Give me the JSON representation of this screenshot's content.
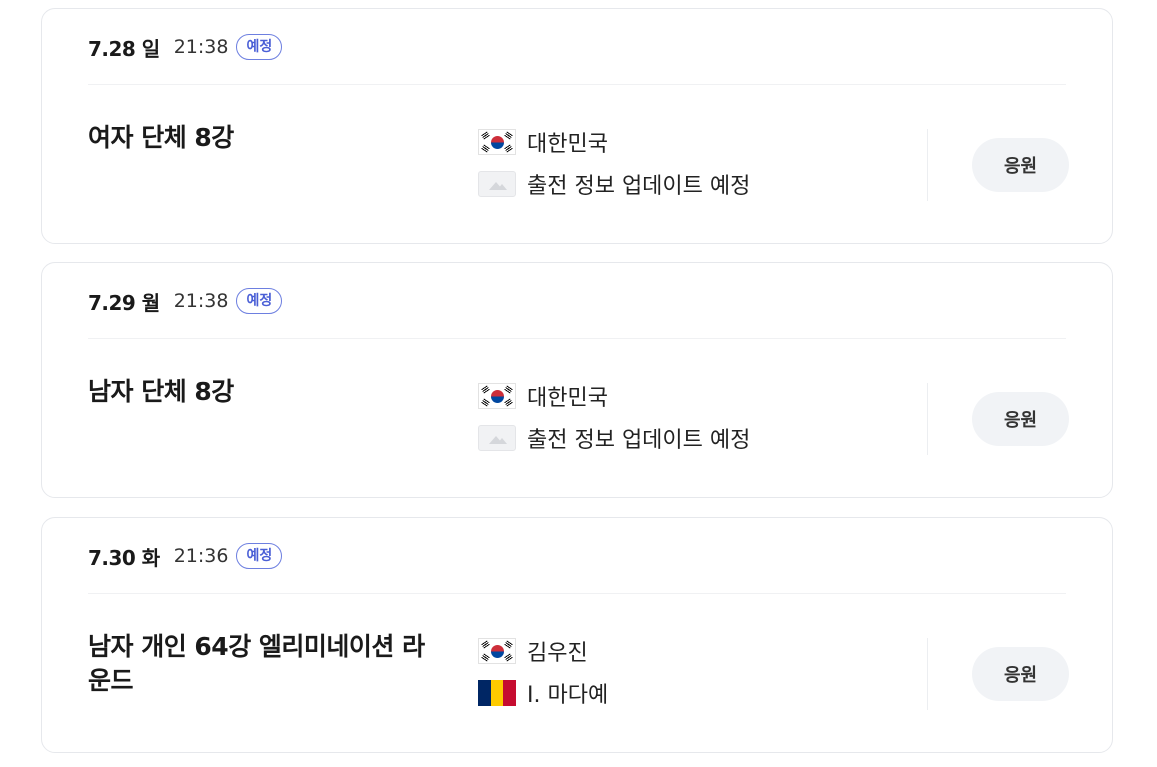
{
  "matches": [
    {
      "date": "7.28 일",
      "time": "21:38",
      "badge": "예정",
      "title": "여자 단체 8강",
      "participants": [
        {
          "flag": "korea-flag",
          "name": "대한민국"
        },
        {
          "flag": "placeholder-image",
          "name": "출전 정보 업데이트 예정"
        }
      ],
      "cheer_label": "응원"
    },
    {
      "date": "7.29 월",
      "time": "21:38",
      "badge": "예정",
      "title": "남자 단체 8강",
      "participants": [
        {
          "flag": "korea-flag",
          "name": "대한민국"
        },
        {
          "flag": "placeholder-image",
          "name": "출전 정보 업데이트 예정"
        }
      ],
      "cheer_label": "응원"
    },
    {
      "date": "7.30 화",
      "time": "21:36",
      "badge": "예정",
      "title": "남자 개인 64강 엘리미네이션 라운드",
      "participants": [
        {
          "flag": "korea-flag",
          "name": "김우진"
        },
        {
          "flag": "chad-flag",
          "name": "I. 마다예"
        }
      ],
      "cheer_label": "응원"
    }
  ],
  "colors": {
    "badge": "#4a5fd6",
    "cheer_button_bg": "#f1f3f6",
    "card_border": "#e6e8ec",
    "chad_blue": "#002664",
    "chad_yellow": "#fecb00",
    "chad_red": "#c60c30"
  }
}
